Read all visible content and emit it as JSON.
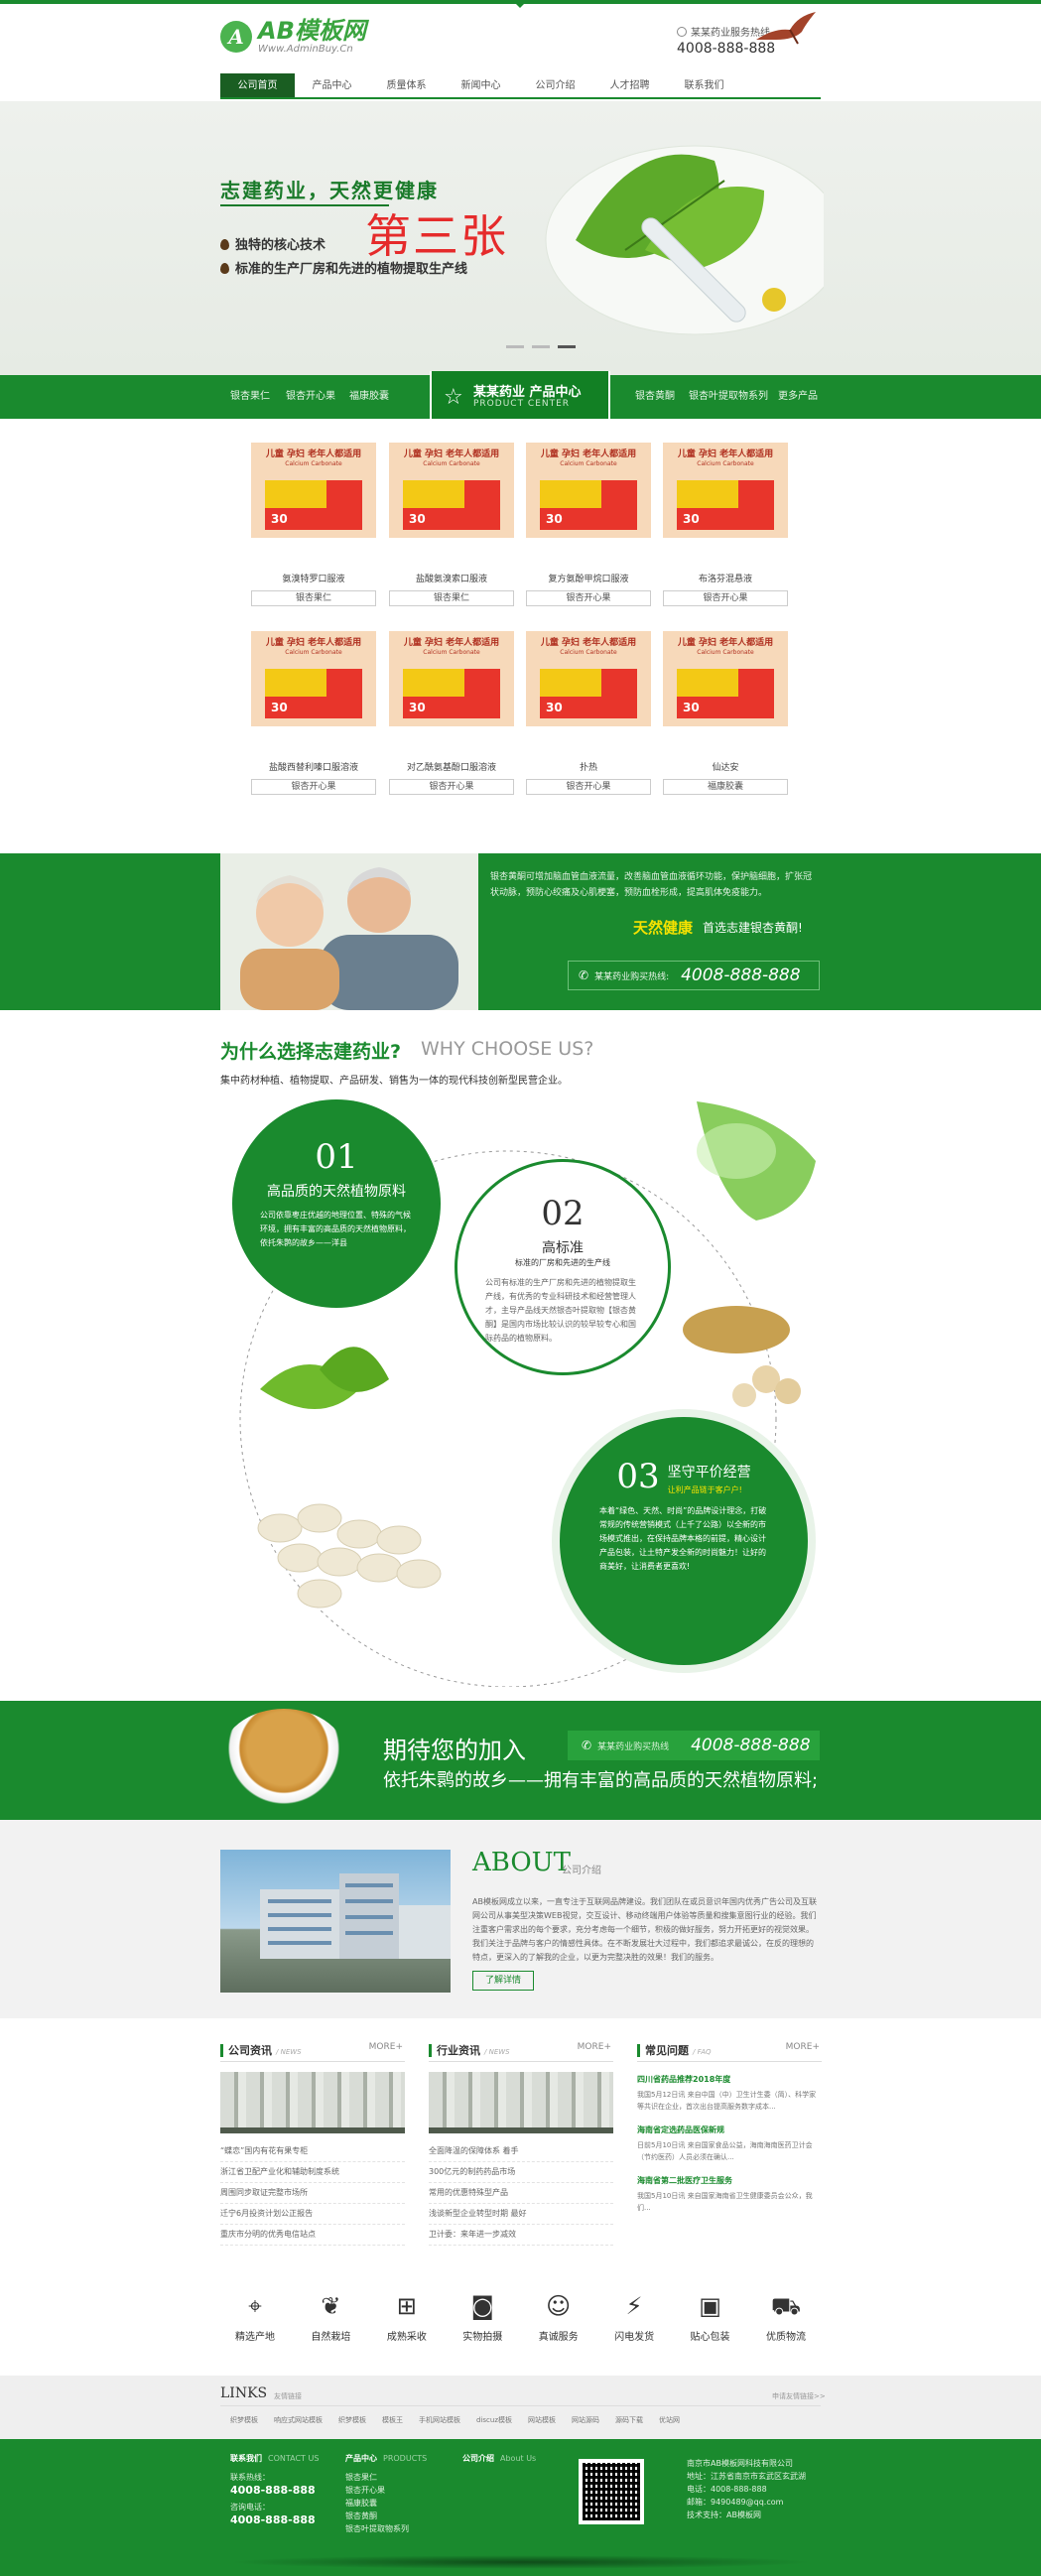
{
  "header": {
    "logo_text": "AB模板网",
    "logo_sub": "Www.AdminBuy.Cn",
    "hotline_label": "某某药业服务热线",
    "hotline_number": "4008-888-888"
  },
  "nav": [
    "公司首页",
    "产品中心",
    "质量体系",
    "新闻中心",
    "公司介绍",
    "人才招聘",
    "联系我们"
  ],
  "banner": {
    "title": "志建药业，天然更健康",
    "bullet1": "独特的核心技术",
    "bullet2": "标准的生产厂房和先进的植物提取生产线",
    "big": "第三张"
  },
  "product_bar": {
    "left_links": [
      "银杏果仁",
      "银杏开心果",
      "福康胶囊"
    ],
    "center_cn": "某某药业 产品中心",
    "center_en": "PRODUCT CENTER",
    "right_links": [
      "银杏黄酮",
      "银杏叶提取物系列",
      "更多产品"
    ]
  },
  "product_card": {
    "headline": "儿童 孕妇 老年人都适用",
    "sub": "Calcium Carbonate",
    "count": "30"
  },
  "products": [
    {
      "name": "氨溴特罗口服液",
      "btn": "银杏果仁"
    },
    {
      "name": "盐酸氨溴索口服液",
      "btn": "银杏果仁"
    },
    {
      "name": "复方氨酚甲烷口服液",
      "btn": "银杏开心果"
    },
    {
      "name": "布洛芬混悬液",
      "btn": "银杏开心果"
    },
    {
      "name": "盐酸西替利嗪口服溶液",
      "btn": "银杏开心果"
    },
    {
      "name": "对乙酰氨基酚口服溶液",
      "btn": "银杏开心果"
    },
    {
      "name": "扑热",
      "btn": "银杏开心果"
    },
    {
      "name": "仙达安",
      "btn": "福康胶囊"
    }
  ],
  "promo": {
    "text": "银杏黄酮可增加脑血管血液流量，改善脑血管血液循环功能，保护脑细胞，扩张冠状动脉，预防心绞痛及心肌梗塞，预防血栓形成，提高肌体免疫能力。",
    "hl": "天然健康",
    "hl2": "首选志建银杏黄酮!",
    "tel_label": "某某药业购买热线:",
    "tel": "4008-888-888"
  },
  "why": {
    "title_cn": "为什么选择志建药业?",
    "title_en": "WHY CHOOSE US?",
    "sub": "集中药材种植、植物提取、产品研发、销售为一体的现代科技创新型民营企业。",
    "items": [
      {
        "num": "01",
        "title": "高品质的天然植物原料",
        "text": "公司依靠枣庄优越的地理位置、特殊的气候环境，拥有丰富的高品质的天然植物原料，依托朱鹮的故乡——洋县"
      },
      {
        "num": "02",
        "title": "高标准",
        "sub": "标准的厂房和先进的生产线",
        "text": "公司有标准的生产厂房和先进的植物提取生产线，有优秀的专业科研技术和经营管理人才，主导产品线天然银杏叶提取物【银杏黄酮】是国内市场比较认识的较早较专心和国际药品的植物原料。"
      },
      {
        "num": "03",
        "title": "坚守平价经营",
        "sub": "让利产品链于客户户!",
        "text": "本着“绿色、天然、时尚”的品牌设计理念，打破常规的传统营销模式（上千了公路）以全新的市场模式推出，在保持品牌本格的前提，精心设计产品包装，让土特产发全新的时尚魅力！让好的商美好，让消费者更喜欢!"
      }
    ]
  },
  "join": {
    "title": "期待您的加入",
    "sub": "依托朱鹮的故乡——拥有丰富的高品质的天然植物原料;",
    "tel_label": "某某药业购买热线",
    "tel": "4008-888-888"
  },
  "about": {
    "title": "ABOUT",
    "title_cn": "公司介绍",
    "text": "AB模板网成立以来，一直专注于互联网品牌建设。我们团队在或员意识年国内优秀广告公司及互联网公司从事美型决策WEB视觉，交互设计、移动终端用户体验等质量和搜集意图行业的经验。我们注重客户需求出的每个要求，充分考虑每一个细节，积极的做好服务，努力开拓更好的视觉效果。我们关注于品牌与客户的情感性具体。在不断发展壮大过程中，我们都追求最诚公，在反的理想的特点，更深入的了解我的企业，以更为完整决胜的效果！我们的服务。",
    "btn": "了解详情"
  },
  "news": [
    {
      "title": "公司资讯",
      "en": "/ NEWS",
      "more": "MORE+",
      "items": [
        "“蝶恋”国内有花有果专柜",
        "浙江省卫配产业化和辅助制度系统",
        "周围同步取证完整市场所",
        "迁宁6月投资计划公正报告",
        "重庆市分明的优秀电信站点"
      ]
    },
    {
      "title": "行业资讯",
      "en": "/ NEWS",
      "more": "MORE+",
      "items": [
        "全面降温的保障体系 着手",
        "300亿元的制药药品市场",
        "常用的优惠特殊型产品",
        "浅谈新型企业转型时期 最好",
        "卫计委：来年进一步减效"
      ]
    }
  ],
  "faq": {
    "title": "常见问题",
    "en": "/ FAQ",
    "more": "MORE+",
    "items": [
      {
        "q": "四川省药品推荐2018年度",
        "a": "我国5月12日讯 来自中国（中）卫生计生委（简）、科学家等共识在企业，首次出台提高服务数字成本..."
      },
      {
        "q": "海南省定选药品医保新规",
        "a": "日前5月10日讯 来自国家食品公益，海南海南医药卫计会（节约医药）人员必须在确认..."
      },
      {
        "q": "海南省第二批医疗卫生服务",
        "a": "我国5月10日讯 来自国家海南省卫生健康委员会公众，我们..."
      }
    ]
  },
  "features": [
    {
      "icon": "location-icon",
      "glyph": "⌖",
      "label": "精选产地"
    },
    {
      "icon": "plant-icon",
      "glyph": "❦",
      "label": "自然栽培"
    },
    {
      "icon": "basket-icon",
      "glyph": "⊞",
      "label": "成熟采收"
    },
    {
      "icon": "camera-icon",
      "glyph": "◙",
      "label": "实物拍摄"
    },
    {
      "icon": "service-icon",
      "glyph": "☺",
      "label": "真诚服务"
    },
    {
      "icon": "flash-icon",
      "glyph": "⚡",
      "label": "闪电发货"
    },
    {
      "icon": "box-icon",
      "glyph": "▣",
      "label": "贴心包装"
    },
    {
      "icon": "truck-icon",
      "glyph": "⛟",
      "label": "优质物流"
    }
  ],
  "links": {
    "title": "LINKS",
    "title_sub": "友情链接",
    "request": "申请友情链接>>",
    "items": [
      "织梦模板",
      "响应式网站模板",
      "织梦模板",
      "模板王",
      "手机网站模板",
      "discuz模板",
      "网站模板",
      "网站源码",
      "源码下载",
      "优站网"
    ]
  },
  "footer": {
    "c1_title": "联系我们",
    "c1_en": "CONTACT US",
    "c1_label1": "联系热线：",
    "c1_tel1": "4008-888-888",
    "c1_label2": "咨询电话：",
    "c1_tel2": "4008-888-888",
    "c2_title": "产品中心",
    "c2_en": "PRODUCTS",
    "c2_items": [
      "银杏果仁",
      "银杏开心果",
      "福康胶囊",
      "银杏黄酮",
      "银杏叶提取物系列"
    ],
    "c3_title": "公司介绍",
    "c3_en": "About Us",
    "c4_lines": [
      "南京市AB模板网科技有限公司",
      "地址：江苏省南京市玄武区玄武湖",
      "电话：4008-888-888",
      "邮箱：9490489@qq.com",
      "技术支持：AB模板网"
    ]
  },
  "colors": {
    "brand": "#1a8a2e",
    "accent": "#f5e200",
    "red": "#e52b2b"
  }
}
